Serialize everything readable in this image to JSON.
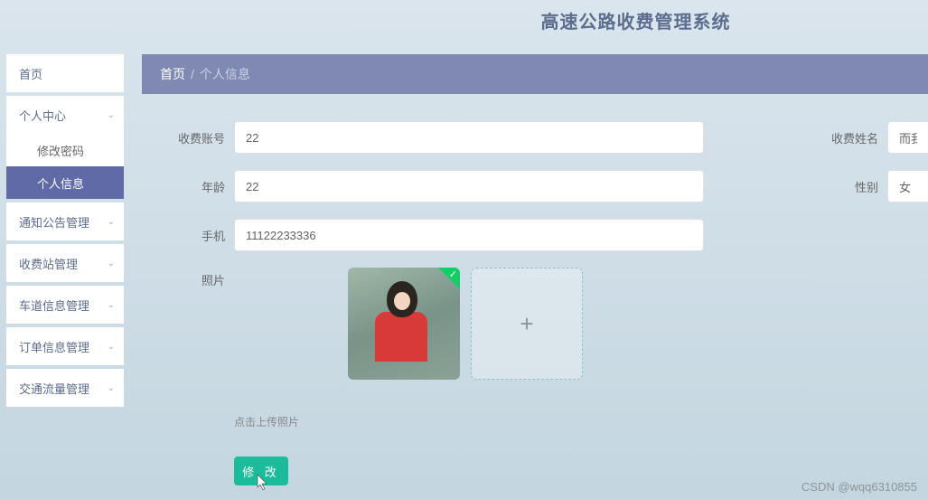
{
  "header": {
    "title": "高速公路收费管理系统"
  },
  "sidebar": {
    "items": [
      {
        "label": "首页"
      },
      {
        "label": "个人中心",
        "children": [
          {
            "label": "修改密码"
          },
          {
            "label": "个人信息"
          }
        ]
      },
      {
        "label": "通知公告管理"
      },
      {
        "label": "收费站管理"
      },
      {
        "label": "车道信息管理"
      },
      {
        "label": "订单信息管理"
      },
      {
        "label": "交通流量管理"
      }
    ]
  },
  "breadcrumb": {
    "root": "首页",
    "sep": "/",
    "current": "个人信息"
  },
  "form": {
    "account_label": "收费账号",
    "account_value": "22",
    "name_label": "收费姓名",
    "name_value": "而我",
    "age_label": "年龄",
    "age_value": "22",
    "gender_label": "性别",
    "gender_value": "女",
    "phone_label": "手机",
    "phone_value": "11122233336",
    "photo_label": "照片",
    "upload_hint": "点击上传照片",
    "submit_label": "修 改"
  },
  "icons": {
    "chevron_down": "⌄",
    "plus": "+",
    "cursor": "↖"
  },
  "watermark": "CSDN @wqq6310855"
}
